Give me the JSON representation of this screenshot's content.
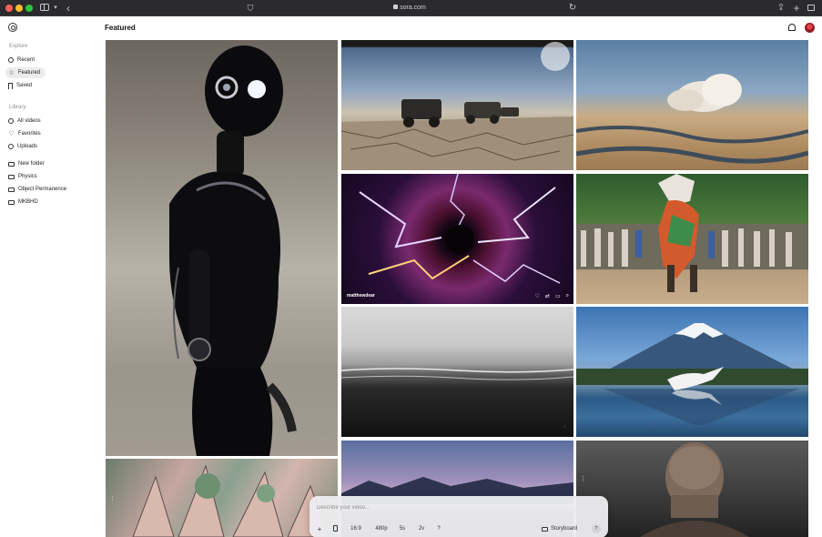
{
  "browser": {
    "address": "sora.com"
  },
  "sidebar": {
    "sections": [
      {
        "label": "Explore",
        "items": [
          {
            "label": "Recent",
            "icon": "clock-icon"
          },
          {
            "label": "Featured",
            "icon": "star-icon",
            "active": true
          },
          {
            "label": "Saved",
            "icon": "bookmark-icon"
          }
        ]
      },
      {
        "label": "Library",
        "items": [
          {
            "label": "All videos",
            "icon": "grid-icon"
          },
          {
            "label": "Favorites",
            "icon": "heart-icon"
          },
          {
            "label": "Uploads",
            "icon": "upload-icon"
          }
        ]
      }
    ],
    "folders": [
      {
        "label": "New folder",
        "icon": "new-folder-icon"
      },
      {
        "label": "Physics",
        "icon": "folder-icon"
      },
      {
        "label": "Object Permanence",
        "icon": "folder-icon"
      },
      {
        "label": "MKBHD",
        "icon": "folder-icon"
      }
    ]
  },
  "header": {
    "title": "Featured"
  },
  "grid": {
    "hovered_caption": "matthewdear"
  },
  "prompt": {
    "placeholder": "Describe your video...",
    "aspect_ratio": "16:9",
    "resolution": "480p",
    "duration": "5s",
    "variations": "2v",
    "help": "?",
    "storyboard_label": "Storyboard",
    "add_label": "+"
  },
  "colors": {
    "accent": "#1c1c1e",
    "active_item_bg": "#ececee"
  }
}
